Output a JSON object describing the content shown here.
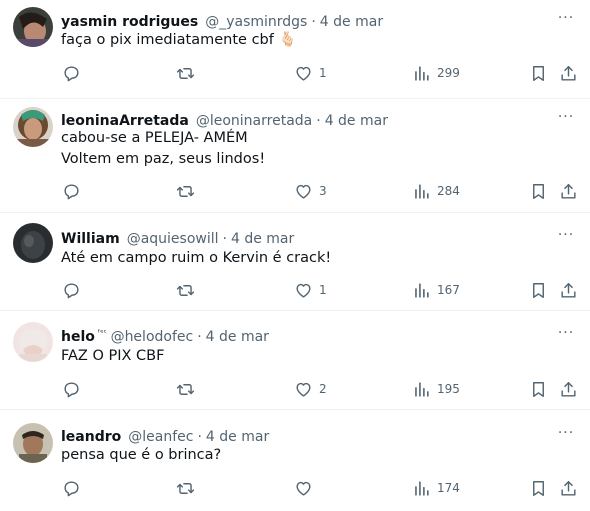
{
  "replies": [
    {
      "display_name": "yasmin rodrigues",
      "name_suffix": "",
      "handle": "@_yasminrdgs",
      "date": "4 de mar",
      "text": "faça o pix imediatamente cbf 🫰🏻",
      "reply_count": "",
      "retweet_count": "",
      "like_count": "1",
      "view_count": "299"
    },
    {
      "display_name": "leoninaArretada",
      "name_suffix": "",
      "handle": "@leoninarretada",
      "date": "4 de mar",
      "text": "cabou-se a PELEJA- AMÉM\nVoltem em paz, seus lindos!",
      "reply_count": "",
      "retweet_count": "",
      "like_count": "3",
      "view_count": "284"
    },
    {
      "display_name": "William",
      "name_suffix": "",
      "handle": "@aquiesowill",
      "date": "4 de mar",
      "text": "Até em campo ruim o Kervin é crack!",
      "reply_count": "",
      "retweet_count": "",
      "like_count": "1",
      "view_count": "167"
    },
    {
      "display_name": "helo",
      "name_suffix": "ᶠᵉᶜ",
      "handle": "@helodofec",
      "date": "4 de mar",
      "text": "FAZ O PIX CBF",
      "reply_count": "",
      "retweet_count": "",
      "like_count": "2",
      "view_count": "195"
    },
    {
      "display_name": "leandro",
      "name_suffix": "",
      "handle": "@leanfec",
      "date": "4 de mar",
      "text": "pensa que é o brinca?",
      "reply_count": "",
      "retweet_count": "",
      "like_count": "",
      "view_count": "174"
    }
  ],
  "icons": {
    "reply": "reply-icon",
    "retweet": "retweet-icon",
    "like": "heart-icon",
    "views": "views-icon",
    "bookmark": "bookmark-icon",
    "share": "share-icon",
    "more": "more-icon"
  },
  "colors": {
    "text_primary": "#0f1419",
    "text_secondary": "#536471",
    "divider": "#eff3f4",
    "background": "#ffffff"
  }
}
